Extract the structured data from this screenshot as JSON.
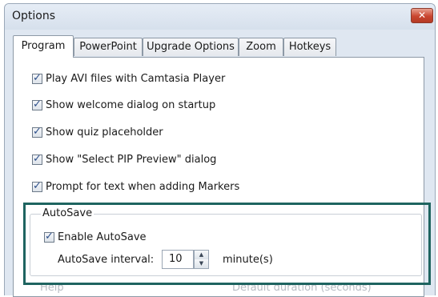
{
  "window": {
    "title": "Options",
    "close_glyph": "✕"
  },
  "tabs": [
    {
      "label": "Program",
      "active": true
    },
    {
      "label": "PowerPoint",
      "active": false
    },
    {
      "label": "Upgrade Options",
      "active": false
    },
    {
      "label": "Zoom",
      "active": false
    },
    {
      "label": "Hotkeys",
      "active": false
    }
  ],
  "options": [
    {
      "label": "Play AVI files with Camtasia Player",
      "checked": true
    },
    {
      "label": "Show welcome dialog on startup",
      "checked": true
    },
    {
      "label": "Show quiz placeholder",
      "checked": true
    },
    {
      "label": "Show \"Select PIP Preview\" dialog",
      "checked": true
    },
    {
      "label": "Prompt for text when adding Markers",
      "checked": true
    }
  ],
  "autosave": {
    "group_label": "AutoSave",
    "enable_label": "Enable AutoSave",
    "enabled": true,
    "interval_label": "AutoSave interval:",
    "interval_value": "10",
    "unit_label": "minute(s)"
  },
  "faded_below": {
    "left_label": "Help",
    "right_label": "Default duration (seconds)"
  },
  "colors": {
    "highlight_border": "#1e6460",
    "close_button": "#c9452f"
  }
}
